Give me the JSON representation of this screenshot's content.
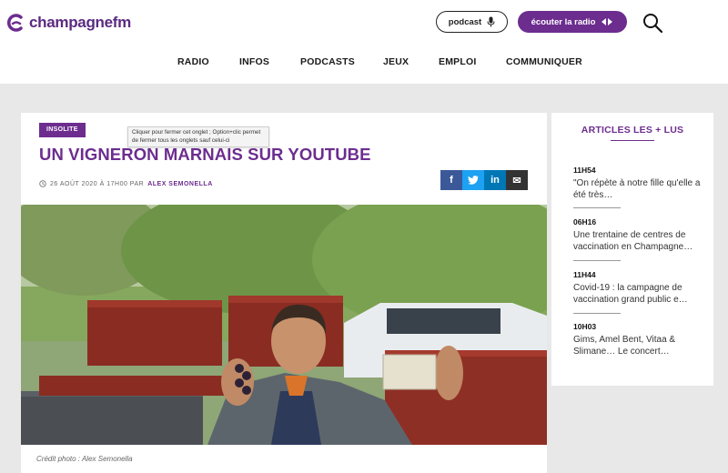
{
  "header": {
    "logo_text": "champagnefm",
    "podcast_label": "podcast",
    "radio_label": "écouter la radio",
    "brand_color": "#6c2d8f"
  },
  "nav": {
    "items": [
      "RADIO",
      "INFOS",
      "PODCASTS",
      "JEUX",
      "EMPLOI",
      "COMMUNIQUER"
    ]
  },
  "article": {
    "tag": "INSOLITE",
    "tooltip": "Cliquer pour fermer cet onglet ; Option+clic permet de fermer tous les onglets sauf celui-ci",
    "title": "UN VIGNERON MARNAIS SUR YOUTUBE",
    "date": "26 AOÛT 2020 À 17H00 PAR",
    "author": "ALEX SEMONELLA",
    "share": [
      {
        "icon": "facebook-icon",
        "glyph": "f",
        "color": "#3b5998"
      },
      {
        "icon": "twitter-icon",
        "glyph": "t",
        "color": "#1da1f2"
      },
      {
        "icon": "linkedin-icon",
        "glyph": "in",
        "color": "#0077b5"
      },
      {
        "icon": "mail-icon",
        "glyph": "✉",
        "color": "#333333"
      }
    ],
    "credit": "Crédit photo : Alex Semonella"
  },
  "sidebar": {
    "title": "ARTICLES LES + LUS",
    "items": [
      {
        "time": "11H54",
        "text": "\"On répète à notre fille qu'elle a été très…"
      },
      {
        "time": "06H16",
        "text": "Une trentaine de centres de vaccination en Champagne…"
      },
      {
        "time": "11H44",
        "text": "Covid-19 : la campagne de vaccination grand public e…"
      },
      {
        "time": "10H03",
        "text": "Gims, Amel Bent, Vitaa & Slimane… Le concert…"
      }
    ]
  }
}
